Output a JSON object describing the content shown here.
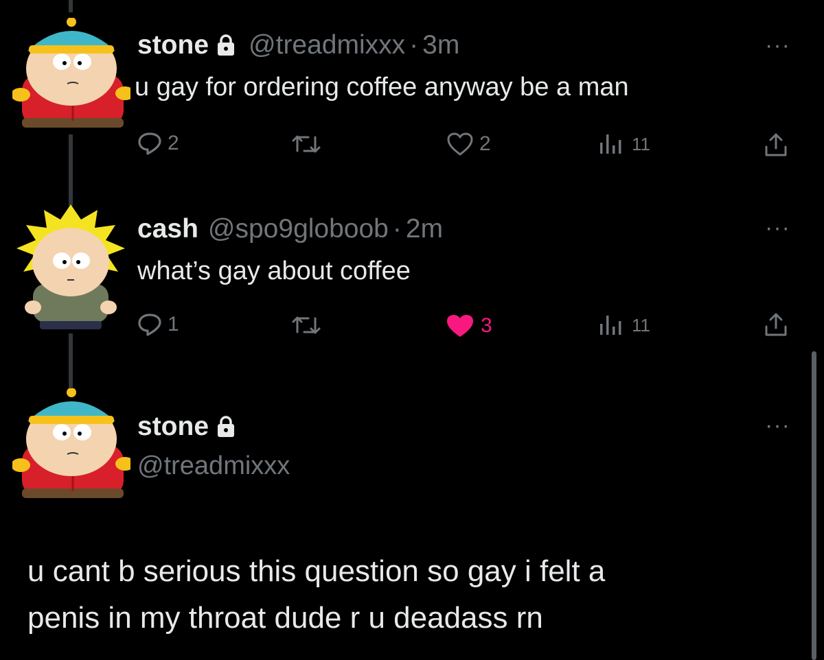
{
  "tweets": [
    {
      "name": "stone",
      "handle": "@treadmixxx",
      "time": "3m",
      "text": "u gay for ordering coffee anyway be a man",
      "replies": "2",
      "reposts": "",
      "likes": "2",
      "views": "11",
      "liked": false,
      "avatar": "cartman-avatar",
      "protected": true
    },
    {
      "name": "cash",
      "handle": "@spo9globoob",
      "time": "2m",
      "text": "what’s gay about coffee",
      "replies": "1",
      "reposts": "",
      "likes": "3",
      "views": "11",
      "liked": true,
      "avatar": "tweek-avatar",
      "protected": false
    }
  ],
  "focused_tweet": {
    "name": "stone",
    "handle": "@treadmixxx",
    "protected": true,
    "avatar": "cartman-avatar",
    "text_line1": "u cant b serious this question so gay i felt a",
    "text_line2": "penis in my throat dude r u deadass rn"
  },
  "ui": {
    "separator": "·",
    "more": "···"
  },
  "colors": {
    "background": "#000000",
    "text": "#e7e9ea",
    "muted": "#71767b",
    "like_active": "#f91880"
  }
}
